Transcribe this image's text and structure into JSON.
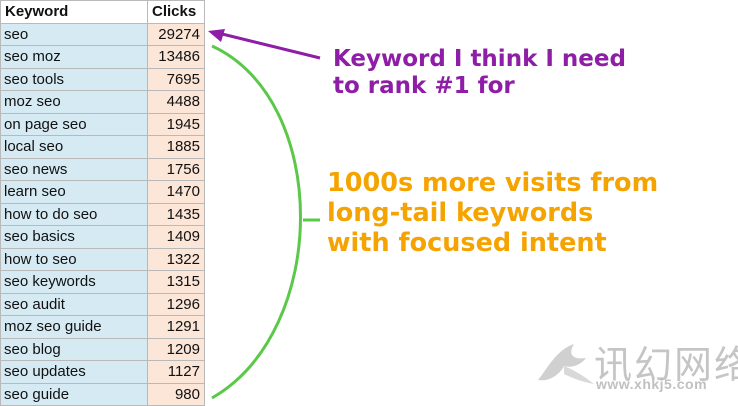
{
  "table": {
    "headers": {
      "keyword": "Keyword",
      "clicks": "Clicks"
    },
    "rows": [
      {
        "keyword": "seo",
        "clicks": "29274"
      },
      {
        "keyword": "seo moz",
        "clicks": "13486"
      },
      {
        "keyword": "seo tools",
        "clicks": "7695"
      },
      {
        "keyword": "moz seo",
        "clicks": "4488"
      },
      {
        "keyword": "on page seo",
        "clicks": "1945"
      },
      {
        "keyword": "local seo",
        "clicks": "1885"
      },
      {
        "keyword": "seo news",
        "clicks": "1756"
      },
      {
        "keyword": "learn seo",
        "clicks": "1470"
      },
      {
        "keyword": "how to do seo",
        "clicks": "1435"
      },
      {
        "keyword": "seo basics",
        "clicks": "1409"
      },
      {
        "keyword": "how to seo",
        "clicks": "1322"
      },
      {
        "keyword": "seo keywords",
        "clicks": "1315"
      },
      {
        "keyword": "seo audit",
        "clicks": "1296"
      },
      {
        "keyword": "moz seo guide",
        "clicks": "1291"
      },
      {
        "keyword": "seo blog",
        "clicks": "1209"
      },
      {
        "keyword": "seo updates",
        "clicks": "1127"
      },
      {
        "keyword": "seo guide",
        "clicks": "980"
      }
    ]
  },
  "annotations": {
    "head_keyword": {
      "lines": [
        "Keyword I think I need",
        "to rank #1 for"
      ],
      "color": "#8e1ea6"
    },
    "long_tail": {
      "lines": [
        "1000s more visits from",
        "long-tail keywords",
        "with focused intent"
      ],
      "color": "#f5a300"
    },
    "bracket_color": "#5cc84a"
  },
  "watermark": {
    "title": "讯幻网络",
    "url": "www.xhkj5.com"
  },
  "colors": {
    "keyword_column_fill": "#d6eaf3",
    "clicks_column_fill": "#fbe6d8",
    "grid_line": "#b9b9b9"
  }
}
